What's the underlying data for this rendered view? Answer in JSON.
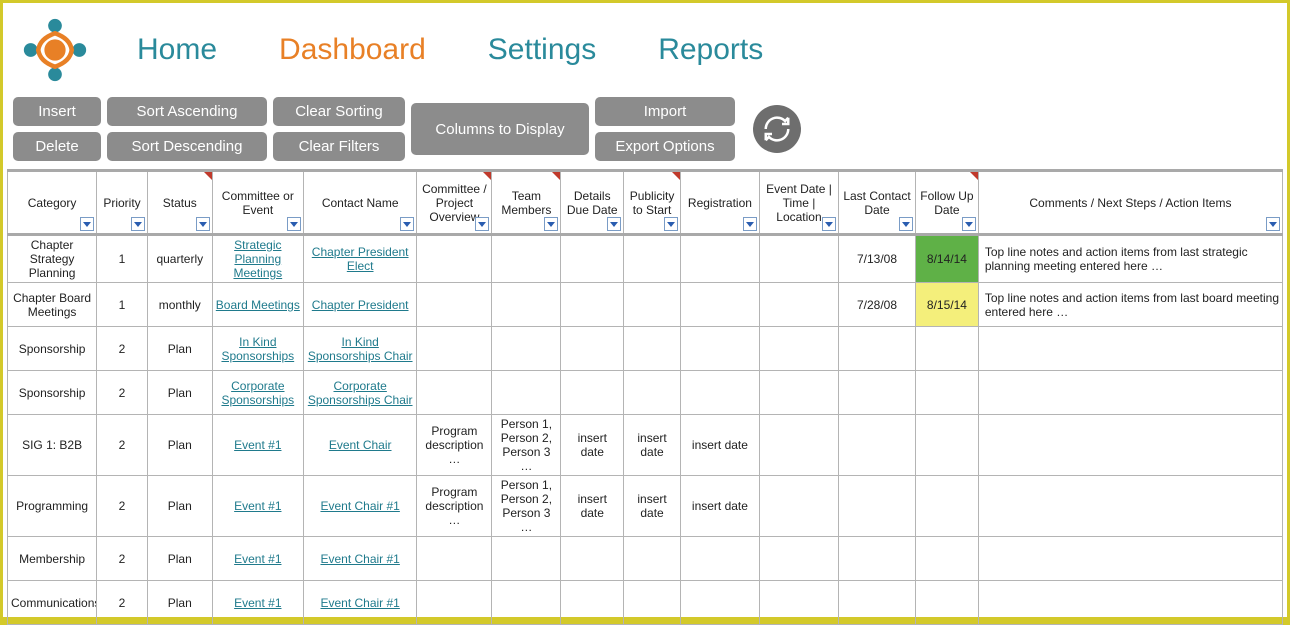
{
  "nav": {
    "home": "Home",
    "dashboard": "Dashboard",
    "settings": "Settings",
    "reports": "Reports"
  },
  "toolbar": {
    "insert": "Insert",
    "delete": "Delete",
    "sort_asc": "Sort Ascending",
    "sort_desc": "Sort Descending",
    "clear_sort": "Clear Sorting",
    "clear_filters": "Clear Filters",
    "columns": "Columns to Display",
    "import": "Import",
    "export": "Export Options"
  },
  "columns": [
    {
      "label": "Category",
      "tri": false
    },
    {
      "label": "Priority",
      "tri": false
    },
    {
      "label": "Status",
      "tri": true
    },
    {
      "label": "Committee or Event",
      "tri": false
    },
    {
      "label": "Contact Name",
      "tri": false
    },
    {
      "label": "Committee / Project Overview",
      "tri": true
    },
    {
      "label": "Team Members",
      "tri": true
    },
    {
      "label": "Details Due Date",
      "tri": false
    },
    {
      "label": "Publicity to Start",
      "tri": true
    },
    {
      "label": "Registration",
      "tri": false
    },
    {
      "label": "Event Date | Time | Location",
      "tri": false
    },
    {
      "label": "Last Contact Date",
      "tri": false
    },
    {
      "label": "Follow Up Date",
      "tri": true
    },
    {
      "label": "Comments / Next Steps / Action Items",
      "tri": false
    }
  ],
  "rows": [
    {
      "category": "Chapter Strategy Planning",
      "priority": "1",
      "status": "quarterly",
      "committee": {
        "text": "Strategic Planning Meetings",
        "link": true
      },
      "contact": {
        "text": "Chapter  President Elect",
        "link": true
      },
      "overview": "",
      "team": "",
      "due": "",
      "publicity": "",
      "registration": "",
      "event": "",
      "lastcontact": "7/13/08",
      "followup": {
        "text": "8/14/14",
        "hl": "green"
      },
      "comments": "Top line notes and action items from last strategic planning meeting entered here  …"
    },
    {
      "category": "Chapter Board Meetings",
      "priority": "1",
      "status": "monthly",
      "committee": {
        "text": "Board Meetings",
        "link": true
      },
      "contact": {
        "text": "Chapter  President",
        "link": true
      },
      "overview": "",
      "team": "",
      "due": "",
      "publicity": "",
      "registration": "",
      "event": "",
      "lastcontact": "7/28/08",
      "followup": {
        "text": "8/15/14",
        "hl": "yellow"
      },
      "comments": "Top line notes and action items from last board meeting entered here  …"
    },
    {
      "category": "Sponsorship",
      "priority": "2",
      "status": "Plan",
      "committee": {
        "text": "In Kind Sponsorships",
        "link": true
      },
      "contact": {
        "text": "In Kind Sponsorships Chair",
        "link": true
      },
      "overview": "",
      "team": "",
      "due": "",
      "publicity": "",
      "registration": "",
      "event": "",
      "lastcontact": "",
      "followup": {
        "text": "",
        "hl": ""
      },
      "comments": ""
    },
    {
      "category": "Sponsorship",
      "priority": "2",
      "status": "Plan",
      "committee": {
        "text": "Corporate Sponsorships",
        "link": true
      },
      "contact": {
        "text": "Corporate Sponsorships Chair",
        "link": true
      },
      "overview": "",
      "team": "",
      "due": "",
      "publicity": "",
      "registration": "",
      "event": "",
      "lastcontact": "",
      "followup": {
        "text": "",
        "hl": ""
      },
      "comments": ""
    },
    {
      "category": "SIG 1: B2B",
      "priority": "2",
      "status": "Plan",
      "committee": {
        "text": "Event #1",
        "link": true
      },
      "contact": {
        "text": "Event Chair ",
        "link": true
      },
      "overview": "Program description …",
      "team": "Person 1, Person 2, Person 3 …",
      "due": "insert date",
      "publicity": "insert date",
      "registration": "insert date",
      "event": "",
      "lastcontact": "",
      "followup": {
        "text": "",
        "hl": ""
      },
      "comments": ""
    },
    {
      "category": "Programming",
      "priority": "2",
      "status": "Plan",
      "committee": {
        "text": "Event #1",
        "link": true
      },
      "contact": {
        "text": "Event Chair #1",
        "link": true
      },
      "overview": "Program description …",
      "team": "Person 1, Person 2, Person 3 …",
      "due": "insert date",
      "publicity": "insert date",
      "registration": "insert date",
      "event": "",
      "lastcontact": "",
      "followup": {
        "text": "",
        "hl": ""
      },
      "comments": ""
    },
    {
      "category": "Membership",
      "priority": "2",
      "status": "Plan",
      "committee": {
        "text": "Event #1",
        "link": true
      },
      "contact": {
        "text": "Event Chair #1",
        "link": true
      },
      "overview": "",
      "team": "",
      "due": "",
      "publicity": "",
      "registration": "",
      "event": "",
      "lastcontact": "",
      "followup": {
        "text": "",
        "hl": ""
      },
      "comments": ""
    },
    {
      "category": "Communications",
      "priority": "2",
      "status": "Plan",
      "committee": {
        "text": "Event #1",
        "link": true
      },
      "contact": {
        "text": "Event Chair #1",
        "link": true
      },
      "overview": "",
      "team": "",
      "due": "",
      "publicity": "",
      "registration": "",
      "event": "",
      "lastcontact": "",
      "followup": {
        "text": "",
        "hl": ""
      },
      "comments": ""
    }
  ]
}
